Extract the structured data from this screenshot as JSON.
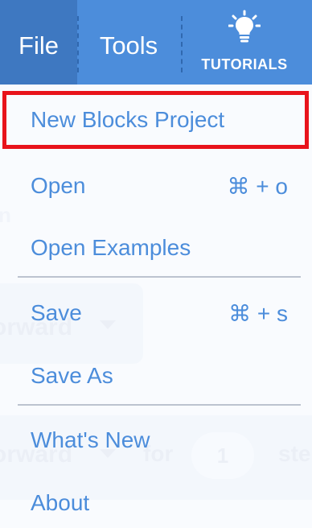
{
  "menubar": {
    "file_label": "File",
    "tools_label": "Tools",
    "tutorials_label": "TUTORIALS",
    "tutorials_icon": "lightbulb-icon"
  },
  "file_menu": {
    "items": [
      {
        "label": "New Blocks Project",
        "shortcut": ""
      },
      {
        "label": "Open",
        "shortcut": "⌘ + o"
      },
      {
        "label": "Open Examples",
        "shortcut": ""
      },
      {
        "label": "Save",
        "shortcut": "⌘ + s"
      },
      {
        "label": "Save As",
        "shortcut": ""
      },
      {
        "label": "What's New",
        "shortcut": ""
      },
      {
        "label": "About",
        "shortcut": ""
      }
    ]
  },
  "background": {
    "partial_letter": "n",
    "block1_text": "orward",
    "block2_text": "orward",
    "for_label": "for",
    "steps_value": "1",
    "steps_label": "ste"
  },
  "colors": {
    "menubar": "#4c8ddb",
    "file_active": "#3e78c1",
    "menu_text": "#4c8ddb",
    "highlight_border": "#e8131b"
  }
}
